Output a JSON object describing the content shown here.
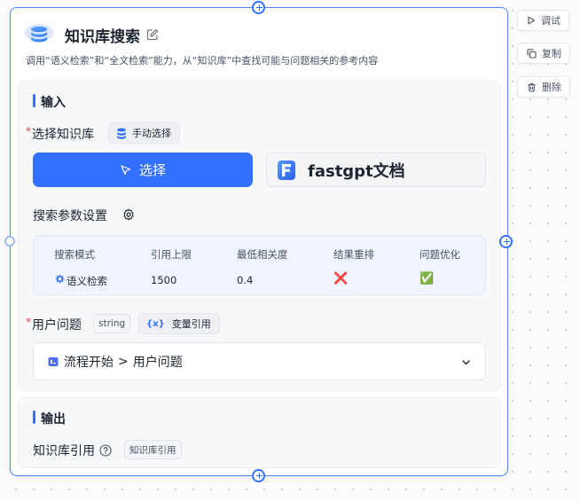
{
  "node": {
    "title": "知识库搜索",
    "description": "调用“语义检索”和“全文检索”能力，从“知识库”中查找可能与问题相关的参考内容"
  },
  "side_actions": {
    "debug": "调试",
    "copy": "复制",
    "delete": "删除"
  },
  "input_section": {
    "title": "输入",
    "select_kb": {
      "required_mark": "*",
      "label": "选择知识库",
      "mode_tag": "手动选择",
      "select_button": "选择",
      "selected_kb_name": "fastgpt文档"
    },
    "search_params": {
      "label": "搜索参数设置",
      "columns": [
        "搜索模式",
        "引用上限",
        "最低相关度",
        "结果重排",
        "问题优化"
      ],
      "row": {
        "mode": "语义检索",
        "limit": "1500",
        "min_similarity": "0.4",
        "rerank": "❌",
        "query_extension": "✅"
      }
    },
    "user_question": {
      "required_mark": "*",
      "label": "用户问题",
      "type_tag": "string",
      "ref_tag_icon": "{x}",
      "ref_tag": "变量引用",
      "ref_source": "流程开始",
      "ref_separator": ">",
      "ref_target": "用户问题"
    }
  },
  "output_section": {
    "title": "输出",
    "field_label": "知识库引用",
    "field_tag": "知识库引用"
  },
  "colors": {
    "accent": "#3370ff",
    "node_border": "#4e83fd",
    "required": "#e53e3e"
  },
  "icons": [
    "database-icon",
    "edit-icon",
    "play-icon",
    "copy-icon",
    "trash-icon",
    "cursor-icon",
    "fastgpt-logo-icon",
    "gear-icon",
    "semantic-search-icon",
    "variable-icon",
    "start-node-icon",
    "chevron-down-icon",
    "help-icon",
    "add-handle-icon"
  ]
}
